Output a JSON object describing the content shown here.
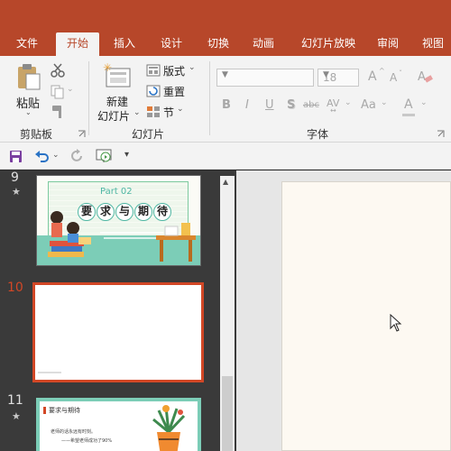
{
  "ribbon_tabs": [
    "文件",
    "开始",
    "插入",
    "设计",
    "切换",
    "动画",
    "幻灯片放映",
    "审阅",
    "视图"
  ],
  "clipboard": {
    "paste": "粘贴",
    "group": "剪贴板"
  },
  "slides_group": {
    "new_slide_line1": "新建",
    "new_slide_line2": "幻灯片",
    "layout": "版式",
    "reset": "重置",
    "section": "节",
    "group": "幻灯片"
  },
  "font_group": {
    "font_size": "18",
    "bold": "B",
    "italic": "I",
    "underline": "U",
    "shadow": "S",
    "strike": "abc",
    "char_spacing": "AV",
    "case": "Aa",
    "font_color": "A",
    "grow": "A",
    "shrink": "A",
    "group": "字体"
  },
  "slides": [
    {
      "number": "9",
      "part": "Part 02",
      "title_chars": [
        "要",
        "求",
        "与",
        "期",
        "待"
      ]
    },
    {
      "number": "10"
    },
    {
      "number": "11",
      "title": "要求与期待",
      "line1": "老师的话永远有时刻。",
      "line2": "——希望老师成功了90%"
    }
  ],
  "colors": {
    "accent": "#b7472a",
    "active_slide": "#d24726",
    "teal": "#4fb6a3"
  },
  "icons": [
    "paste-icon",
    "cut-icon",
    "copy-icon",
    "format-painter-icon",
    "new-slide-icon",
    "layout-icon",
    "reset-icon",
    "section-icon",
    "save-icon",
    "undo-icon",
    "redo-icon",
    "start-from-beginning-icon",
    "customize-qat-icon",
    "mouse-cursor-icon",
    "dialog-launcher-icon",
    "clear-format-icon"
  ]
}
